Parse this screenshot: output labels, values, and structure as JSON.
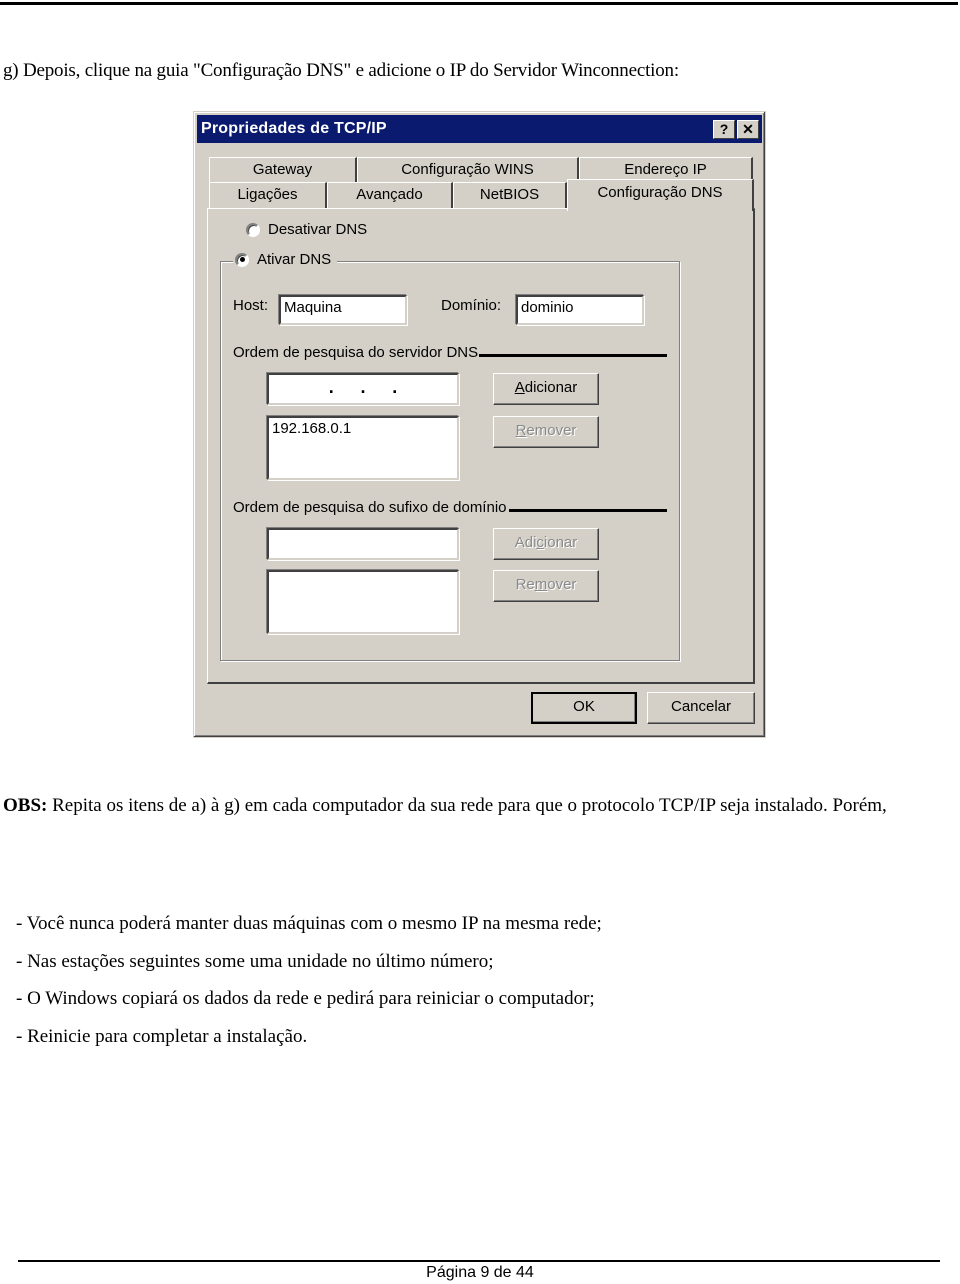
{
  "intro_text": "g) Depois, clique na guia \"Configuração DNS\" e  adicione o IP do Servidor Winconnection:",
  "dialog": {
    "title": "Propriedades de TCP/IP",
    "help_button": "?",
    "close_button": "✕",
    "tabs_row1": [
      "Gateway",
      "Configuração WINS",
      "Endereço IP"
    ],
    "tabs_row2": [
      "Ligações",
      "Avançado",
      "NetBIOS"
    ],
    "active_tab": "Configuração DNS",
    "radio_disable": {
      "label": "Desativar DNS",
      "selected": false
    },
    "radio_enable": {
      "label": "Ativar DNS",
      "selected": true
    },
    "host_label": "Host:",
    "host_value": "Maquina",
    "domain_label": "Domínio:",
    "domain_value": "dominio",
    "dns_order_label": "Ordem de pesquisa do servidor DNS",
    "dns_ip_input": ". . .",
    "dns_list": [
      "192.168.0.1"
    ],
    "dns_add_button": "Adicionar",
    "dns_remove_button": "Remover",
    "suffix_order_label": "Ordem de pesquisa do sufixo de domínio",
    "suffix_input": "",
    "suffix_list": [],
    "suffix_add_button": "Adicionar",
    "suffix_remove_button": "Remover",
    "ok_button": "OK",
    "cancel_button": "Cancelar"
  },
  "obs": {
    "label": "OBS:",
    "text": " Repita os itens de a) à g) em cada computador da sua rede para que o protocolo TCP/IP seja instalado. Porém,"
  },
  "bullets": [
    "- Você nunca poderá manter duas máquinas com o mesmo IP na mesma rede;",
    "- Nas estações seguintes some uma unidade no último número;",
    "- O Windows copiará os dados da rede e pedirá para reiniciar o computador;",
    "- Reinicie para completar a instalação."
  ],
  "footer": "Página 9 de 44"
}
